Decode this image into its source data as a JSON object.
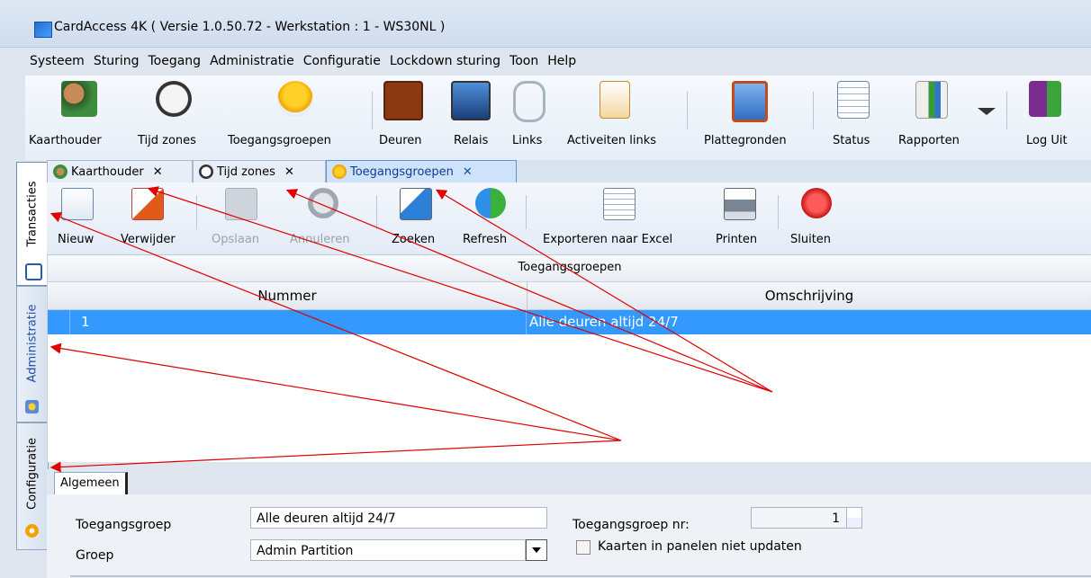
{
  "window": {
    "title": "CardAccess 4K ( Versie 1.0.50.72  -  Werkstation : 1 - WS30NL )"
  },
  "menu": [
    "Systeem",
    "Sturing",
    "Toegang",
    "Administratie",
    "Configuratie",
    "Lockdown sturing",
    "Toon",
    "Help"
  ],
  "main_toolbar": {
    "buttons": [
      {
        "label": "Kaarthouder",
        "icon": "people-icon"
      },
      {
        "label": "Tijd zones",
        "icon": "clock-icon"
      },
      {
        "label": "Toegangsgroepen",
        "icon": "group-icon"
      },
      {
        "label": "Deuren",
        "icon": "door-icon"
      },
      {
        "label": "Relais",
        "icon": "relay-icon"
      },
      {
        "label": "Links",
        "icon": "link-icon"
      },
      {
        "label": "Activeiten links",
        "icon": "activity-link-icon"
      },
      {
        "label": "Plattegronden",
        "icon": "floorplan-icon"
      },
      {
        "label": "Status",
        "icon": "status-icon"
      },
      {
        "label": "Rapporten",
        "icon": "reports-icon"
      },
      {
        "label": "Log Uit",
        "icon": "logout-icon"
      }
    ]
  },
  "left_tabs": [
    {
      "label": "Transacties",
      "active": true
    },
    {
      "label": "Administratie",
      "active": false
    },
    {
      "label": "Configuratie",
      "active": false
    }
  ],
  "doc_tabs": [
    {
      "label": "Kaarthouder",
      "close": "✕"
    },
    {
      "label": "Tijd zones",
      "close": "✕"
    },
    {
      "label": "Toegangsgroepen",
      "close": "✕"
    }
  ],
  "sub_toolbar": {
    "buttons": [
      {
        "label": "Nieuw",
        "enabled": true
      },
      {
        "label": "Verwijder",
        "enabled": true
      },
      {
        "label": "Opslaan",
        "enabled": false
      },
      {
        "label": "Annuleren",
        "enabled": false
      },
      {
        "label": "Zoeken",
        "enabled": true
      },
      {
        "label": "Refresh",
        "enabled": true
      },
      {
        "label": "Exporteren naar Excel",
        "enabled": true
      },
      {
        "label": "Printen",
        "enabled": true
      },
      {
        "label": "Sluiten",
        "enabled": true
      }
    ]
  },
  "grid": {
    "caption": "Toegangsgroepen",
    "columns": [
      "Nummer",
      "Omschrijving"
    ],
    "rows": [
      [
        "1",
        "Alle deuren altijd 24/7"
      ]
    ]
  },
  "detail": {
    "tab": "Algemeen",
    "toegangsgroep_label": "Toegangsgroep",
    "toegangsgroep_value": "Alle deuren altijd 24/7",
    "groep_label": "Groep",
    "groep_value": "Admin Partition",
    "nr_label": "Toegangsgroep nr:",
    "nr_value": "1",
    "checkbox_label": "Kaarten in panelen niet updaten"
  },
  "colors": {
    "selection": "#3399ff",
    "annotation_arrow": "#e00000"
  }
}
